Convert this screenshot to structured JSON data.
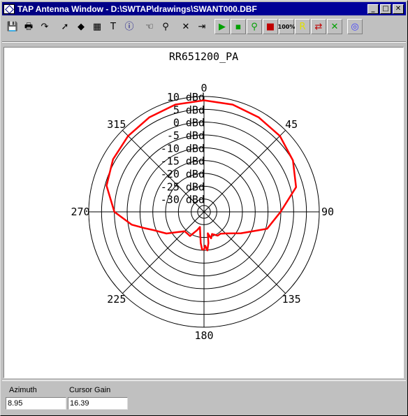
{
  "window": {
    "title": "TAP Antenna Window - D:\\SWTAP\\drawings\\SWANT000.DBF",
    "controls": {
      "minimize": "_",
      "maximize": "□",
      "close": "✕"
    }
  },
  "toolbar": {
    "items": [
      {
        "name": "save-icon",
        "glyph": "💾"
      },
      {
        "name": "print-icon",
        "glyph": "🖶"
      },
      {
        "name": "redo-arrow-icon",
        "glyph": "↷"
      },
      {
        "name": "pointer-icon",
        "glyph": "➚"
      },
      {
        "name": "paint-icon",
        "glyph": "◆"
      },
      {
        "name": "calculator-icon",
        "glyph": "▦"
      },
      {
        "name": "text-icon",
        "glyph": "T"
      },
      {
        "name": "info-icon",
        "glyph": "ⓘ"
      },
      {
        "name": "hand-icon",
        "glyph": "☜"
      },
      {
        "name": "wrench-icon",
        "glyph": "⚲"
      },
      {
        "name": "delete-icon",
        "glyph": "✕"
      },
      {
        "name": "door-exit-icon",
        "glyph": "⇥"
      },
      {
        "name": "green-play-icon",
        "glyph": "▶"
      },
      {
        "name": "green-small-icon",
        "glyph": "▪"
      },
      {
        "name": "pin-icon",
        "glyph": "⚲"
      },
      {
        "name": "red-green-icon",
        "glyph": "■"
      },
      {
        "name": "zoom-100-icon",
        "glyph": "100%"
      },
      {
        "name": "r-icon",
        "glyph": "R"
      },
      {
        "name": "red-arrow-icon",
        "glyph": "⇄"
      },
      {
        "name": "green-x-icon",
        "glyph": "✕"
      },
      {
        "name": "target-icon",
        "glyph": "◎"
      }
    ]
  },
  "plot": {
    "title": "RR651200_PA",
    "ring_labels": [
      "10 dBd",
      "5 dBd",
      "0 dBd",
      "-5 dBd",
      "-10 dBd",
      "-15 dBd",
      "-20 dBd",
      "-25 dBd",
      "-30 dBd"
    ],
    "angle_labels": [
      "0",
      "45",
      "90",
      "135",
      "180",
      "225",
      "270",
      "315"
    ],
    "trace_color": "#ff0000"
  },
  "chart_data": {
    "type": "polar-line",
    "title": "RR651200_PA",
    "radial_axis": {
      "unit": "dBd",
      "min": -35,
      "max": 10,
      "ticks": [
        10,
        5,
        0,
        -5,
        -10,
        -15,
        -20,
        -25,
        -30
      ]
    },
    "angle_axis": {
      "unit": "deg",
      "ticks": [
        0,
        45,
        90,
        135,
        180,
        225,
        270,
        315
      ],
      "zero": "top",
      "direction": "clockwise"
    },
    "series": [
      {
        "color": "#ff0000",
        "azimuth_deg": [
          0,
          15,
          30,
          45,
          60,
          75,
          90,
          105,
          112,
          120,
          135,
          143,
          150,
          160,
          165,
          170,
          172,
          175,
          178,
          180,
          183,
          186,
          190,
          195,
          200,
          210,
          225,
          240,
          250,
          255,
          260,
          270,
          285,
          300,
          315,
          330,
          345
        ],
        "gain_dBd": [
          8.5,
          8.3,
          7.6,
          6.9,
          5.1,
          2.2,
          -5.1,
          -9.5,
          -14.7,
          -18.3,
          -23.1,
          -24.3,
          -24.3,
          -25.8,
          -24.3,
          -26.5,
          -22.7,
          -19.9,
          -21.8,
          -20.3,
          -20.3,
          -22.8,
          -26.5,
          -28.9,
          -27.5,
          -24.1,
          -24.3,
          -18.1,
          -14.1,
          -10.7,
          -6.3,
          0.0,
          4.4,
          6.0,
          6.9,
          7.6,
          8.3
        ]
      }
    ]
  },
  "status": {
    "azimuth_label": "Azimuth",
    "azimuth_value": "8.95",
    "gain_label": "Cursor Gain",
    "gain_value": "16.39"
  }
}
